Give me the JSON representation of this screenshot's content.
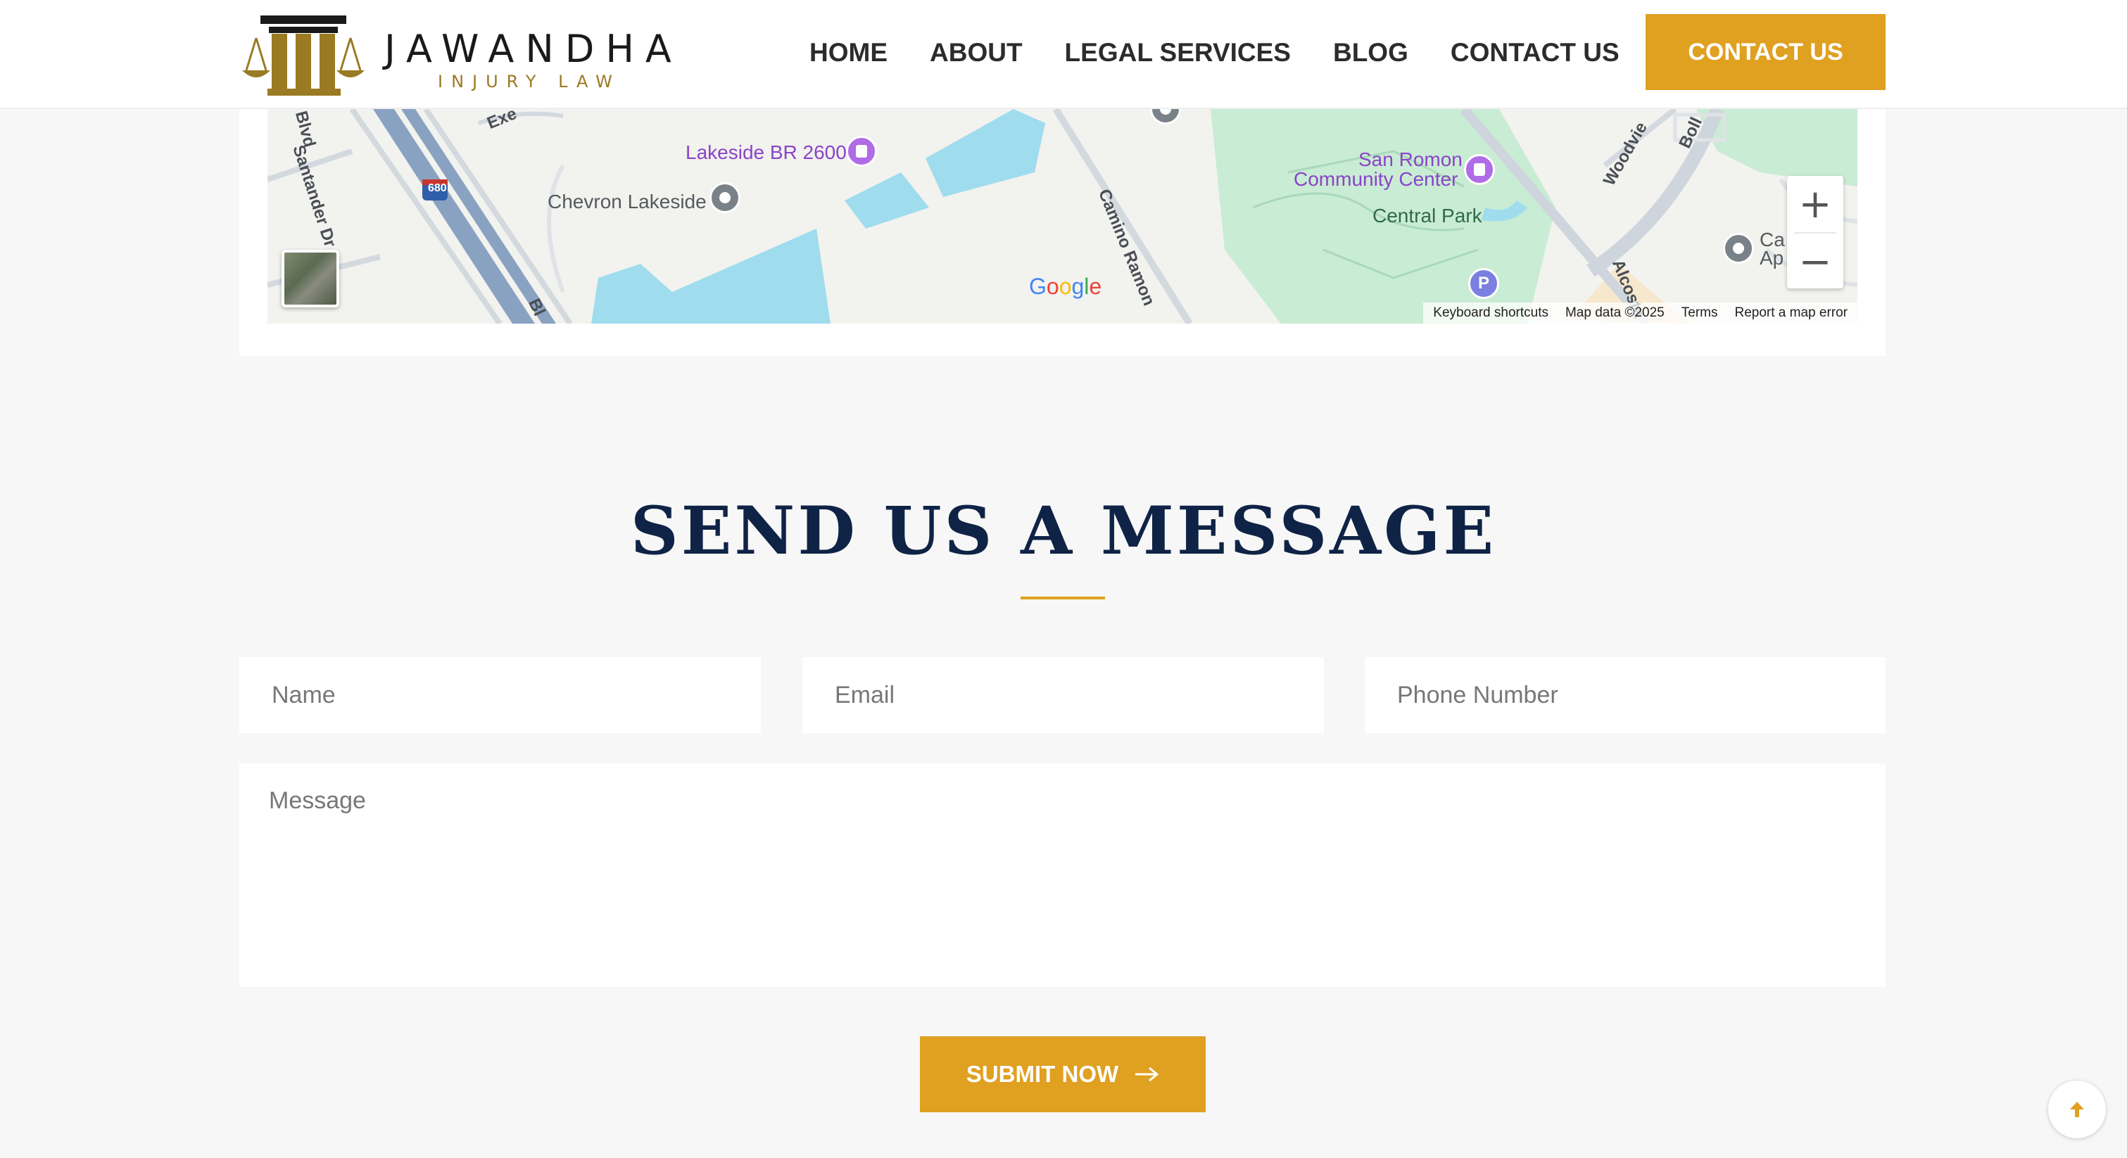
{
  "header": {
    "logo": {
      "name": "JAWANDHA",
      "tagline": "INJURY LAW"
    },
    "nav": [
      "HOME",
      "ABOUT",
      "LEGAL SERVICES",
      "BLOG",
      "CONTACT US"
    ],
    "cta_label": "CONTACT US"
  },
  "map": {
    "places": {
      "lakeside": "Lakeside BR 2600",
      "chevron": "Chevron Lakeside",
      "community_center_line1": "San Romon",
      "community_center_line2": "Community Center",
      "central_park": "Central Park",
      "apartments_line1": "Ca",
      "apartments_line2": "Ap"
    },
    "roads": {
      "santander": "Santander Dr",
      "camino": "Camino Ramon",
      "alcosta": "Alcosta",
      "woodview": "Woodvie",
      "bollinger": "Boll",
      "exec": "Exe",
      "blvd": "Bl",
      "dr_top": "Blvd",
      "interstate": "680",
      "parking": "P"
    },
    "google_logo": "Google",
    "footer": [
      "Keyboard shortcuts",
      "Map data ©2025",
      "Terms",
      "Report a map error"
    ],
    "zoom_in": "+",
    "zoom_out": "−"
  },
  "message_section": {
    "title": "SEND US A MESSAGE",
    "fields": {
      "name_placeholder": "Name",
      "email_placeholder": "Email",
      "phone_placeholder": "Phone Number",
      "message_placeholder": "Message"
    },
    "submit_label": "SUBMIT NOW",
    "submit_icon": "arrow-right-icon",
    "scroll_top_icon": "arrow-up-icon"
  },
  "colors": {
    "accent": "#e0a020",
    "title": "#0f2346",
    "logo_gold": "#9a7a22",
    "page_bg": "#f7f7f7"
  }
}
